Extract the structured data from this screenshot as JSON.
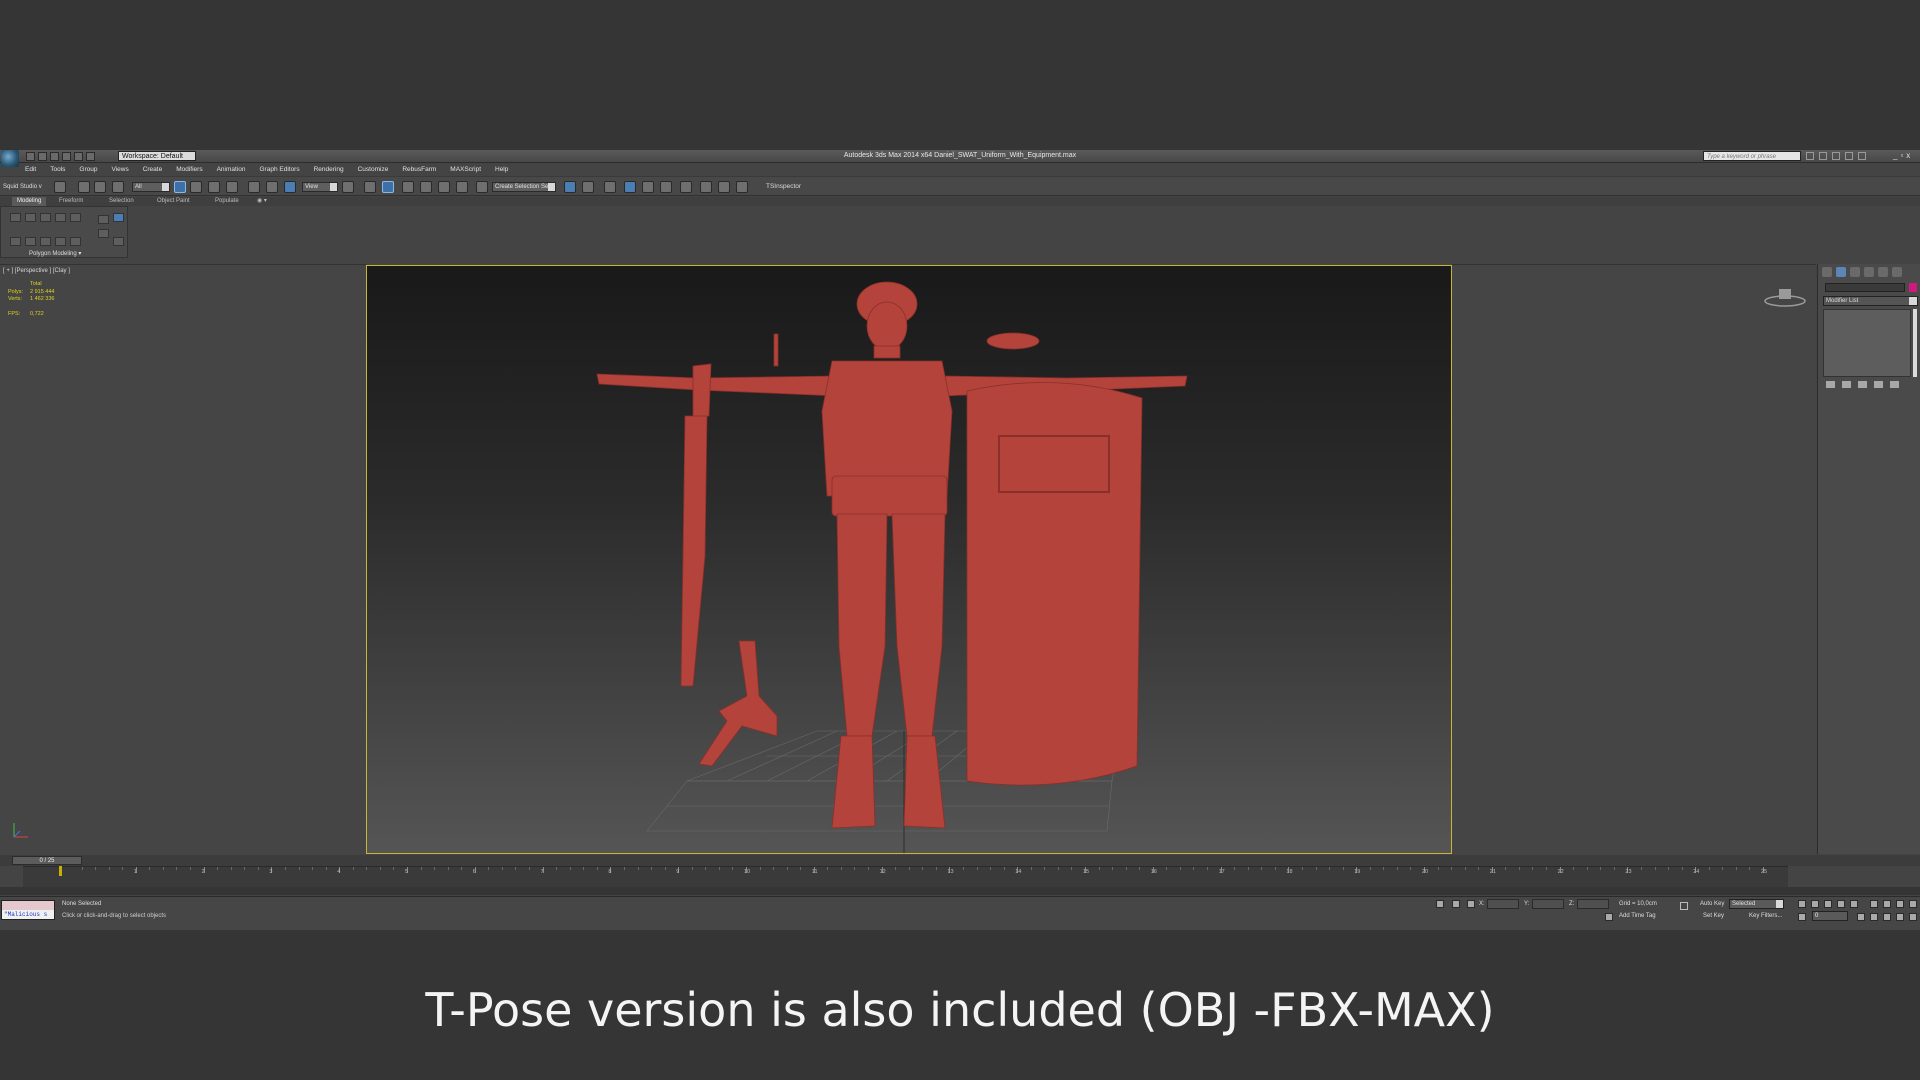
{
  "window": {
    "app_title": "Autodesk 3ds Max 2014 x64     Daniel_SWAT_Uniform_With_Equipment.max",
    "workspace": "Workspace: Default",
    "search_placeholder": "Type a keyword or phrase",
    "window_controls": [
      "_",
      "▫",
      "x"
    ]
  },
  "menu": [
    "Edit",
    "Tools",
    "Group",
    "Views",
    "Create",
    "Modifiers",
    "Animation",
    "Graph Editors",
    "Rendering",
    "Customize",
    "RebusFarm",
    "MAXScript",
    "Help"
  ],
  "toolbar": {
    "squid": "Squid Studio v",
    "filter": "All",
    "ref_coord": "View",
    "selection_set": "Create Selection Se",
    "inspector": "TSInspector"
  },
  "ribbon": {
    "tabs": [
      "Modeling",
      "Freeform",
      "Selection",
      "Object Paint",
      "Populate"
    ],
    "active_tab": "Modeling",
    "panel_label": "Polygon Modeling ▾"
  },
  "viewport": {
    "label": "[ + ] [Perspective ] [Clay ]",
    "stats": {
      "header": "Total",
      "polys_label": "Polys:",
      "polys": "2 915 444",
      "verts_label": "Verts:",
      "verts": "1 462 336",
      "fps_label": "FPS:",
      "fps": "0,722"
    },
    "clay_color": "#b4433b",
    "border_color": "#c8b637"
  },
  "command_panel": {
    "modifier_list": "Modifier List",
    "swatch_color": "#d0187e"
  },
  "timeline": {
    "frame_counter": "0 / 25",
    "ticks": [
      "1",
      "2",
      "3",
      "4",
      "5",
      "6",
      "7",
      "8",
      "9",
      "10",
      "11",
      "12",
      "13",
      "14",
      "15",
      "16",
      "17",
      "18",
      "19",
      "20",
      "21",
      "22",
      "23",
      "24",
      "25"
    ]
  },
  "status": {
    "maxscript": "\"Malicious s",
    "selection": "None Selected",
    "prompt": "Click or click-and-drag to select objects",
    "x_label": "X:",
    "y_label": "Y:",
    "z_label": "Z:",
    "grid": "Grid = 10,0cm",
    "add_time_tag": "Add Time Tag",
    "auto_key": "Auto Key",
    "set_key": "Set Key",
    "key_mode": "Selected",
    "key_filters": "Key Filters...",
    "current_frame": "0"
  },
  "caption": "T-Pose version is also included (OBJ -FBX-MAX)"
}
